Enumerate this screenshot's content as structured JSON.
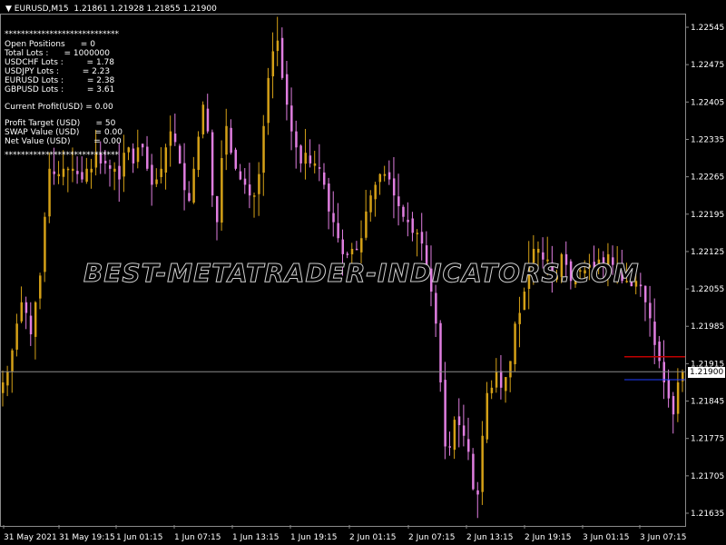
{
  "header": {
    "title": "EURUSD,M15  1.21861 1.21928 1.21855 1.21900"
  },
  "panel": {
    "stars": "****************************",
    "lines": [
      "Open Positions      = 0",
      "Total Lots :      = 1000000",
      "USDCHF Lots :         = 1.78",
      "USDJPY Lots :         = 2.23",
      "EURUSD Lots :         = 2.38",
      "GBPUSD Lots :         = 3.61",
      "",
      "Current Profit(USD) = 0.00",
      "",
      "Profit Target (USD)      = 50",
      "SWAP Value (USD)      = 0.00",
      "Net Value (USD)         = 0.00"
    ]
  },
  "watermark": "BEST-METATRADER-INDICATORS.COM",
  "current_price": "1.21900",
  "colors": {
    "bg": "#000000",
    "grid_axis": "#8a8a8a",
    "bull": "#d4a017",
    "bear": "#e07ee0",
    "red_line": "#c00000",
    "blue_line": "#1e3cff",
    "price_line": "#8a8a8a"
  },
  "chart_data": {
    "type": "candlestick",
    "symbol": "EURUSD",
    "timeframe": "M15",
    "ylim": [
      1.216,
      1.2259
    ],
    "y_ticks": [
      "1.22545",
      "1.22475",
      "1.22405",
      "1.22335",
      "1.22265",
      "1.22195",
      "1.22125",
      "1.22055",
      "1.21985",
      "1.21915",
      "1.21845",
      "1.21775",
      "1.21705",
      "1.21635"
    ],
    "x_ticks": [
      "31 May 2021",
      "31 May 19:15",
      "1 Jun 01:15",
      "1 Jun 07:15",
      "1 Jun 13:15",
      "1 Jun 19:15",
      "2 Jun 01:15",
      "2 Jun 07:15",
      "2 Jun 13:15",
      "2 Jun 19:15",
      "3 Jun 01:15",
      "3 Jun 07:15"
    ],
    "levels": {
      "price_line": 1.219,
      "red_level": 1.21928,
      "blue_level": 1.21885
    },
    "close_path": [
      1.2188,
      1.219,
      1.2194,
      1.2199,
      1.2203,
      1.2201,
      1.2197,
      1.2203,
      1.2208,
      1.2219,
      1.2228,
      1.2227,
      1.2227,
      1.2228,
      1.2228,
      1.2228,
      1.2227,
      1.2226,
      1.2228,
      1.2228,
      1.2231,
      1.2229,
      1.2229,
      1.2228,
      1.2228,
      1.2226,
      1.2231,
      1.2232,
      1.2229,
      1.2232,
      1.2232,
      1.2228,
      1.2225,
      1.2226,
      1.2228,
      1.2232,
      1.2235,
      1.2233,
      1.2229,
      1.2224,
      1.2222,
      1.2228,
      1.2234,
      1.224,
      1.2235,
      1.2223,
      1.2218,
      1.223,
      1.2236,
      1.2231,
      1.2228,
      1.2226,
      1.2225,
      1.2223,
      1.2223,
      1.2227,
      1.2236,
      1.2245,
      1.225,
      1.2252,
      1.2245,
      1.224,
      1.2235,
      1.2232,
      1.2229,
      1.2231,
      1.2229,
      1.2229,
      1.2228,
      1.2225,
      1.222,
      1.2218,
      1.2215,
      1.2212,
      1.2212,
      1.2213,
      1.2213,
      1.2215,
      1.222,
      1.2223,
      1.2225,
      1.2227,
      1.2227,
      1.2226,
      1.2223,
      1.2221,
      1.2219,
      1.2218,
      1.2216,
      1.2216,
      1.2214,
      1.2209,
      1.2205,
      1.2199,
      1.2188,
      1.2176,
      1.2176,
      1.2181,
      1.218,
      1.2178,
      1.2175,
      1.2168,
      1.2167,
      1.2178,
      1.2186,
      1.2187,
      1.219,
      1.2187,
      1.2189,
      1.2192,
      1.2199,
      1.2201,
      1.2205,
      1.221,
      1.2213,
      1.2213,
      1.2211,
      1.2211,
      1.2208,
      1.2208,
      1.2212,
      1.221,
      1.2207,
      1.2209,
      1.2209,
      1.2209,
      1.221,
      1.2209,
      1.2211,
      1.221,
      1.2212,
      1.221,
      1.221,
      1.2207,
      1.2207,
      1.2206,
      1.2207,
      1.2206,
      1.2203,
      1.22,
      1.2195,
      1.2192,
      1.2188,
      1.2185,
      1.2182,
      1.2188,
      1.219
    ]
  }
}
